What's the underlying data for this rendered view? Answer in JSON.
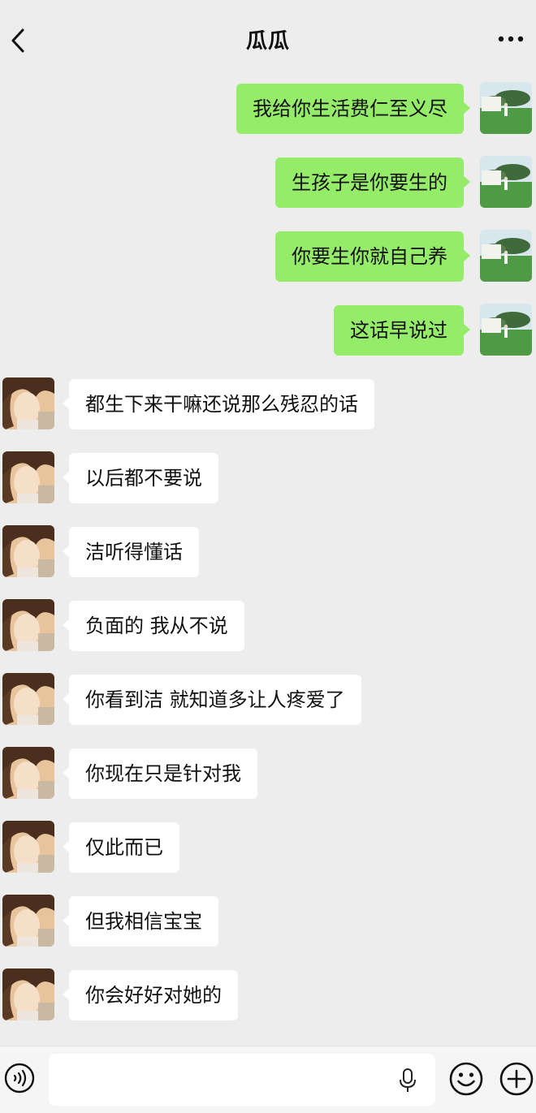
{
  "header": {
    "title": "瓜瓜"
  },
  "messages": [
    {
      "side": "right",
      "text": "我给你生活费仁至义尽"
    },
    {
      "side": "right",
      "text": "生孩子是你要生的"
    },
    {
      "side": "right",
      "text": "你要生你就自己养"
    },
    {
      "side": "right",
      "text": "这话早说过"
    },
    {
      "side": "left",
      "text": "都生下来干嘛还说那么残忍的话"
    },
    {
      "side": "left",
      "text": "以后都不要说"
    },
    {
      "side": "left",
      "text": "洁听得懂话"
    },
    {
      "side": "left",
      "text": "负面的 我从不说"
    },
    {
      "side": "left",
      "text": "你看到洁 就知道多让人疼爱了"
    },
    {
      "side": "left",
      "text": "你现在只是针对我"
    },
    {
      "side": "left",
      "text": "仅此而已"
    },
    {
      "side": "left",
      "text": "但我相信宝宝"
    },
    {
      "side": "left",
      "text": "你会好好对她的"
    }
  ],
  "input_bar": {
    "value": ""
  },
  "colors": {
    "outgoing_bubble": "#95ec69",
    "incoming_bubble": "#ffffff",
    "background": "#ededed"
  },
  "icons": {
    "back": "chevron-left-icon",
    "more": "more-dots-icon",
    "voice": "voice-icon",
    "mic": "microphone-icon",
    "emoji": "emoji-icon",
    "plus": "plus-icon"
  }
}
